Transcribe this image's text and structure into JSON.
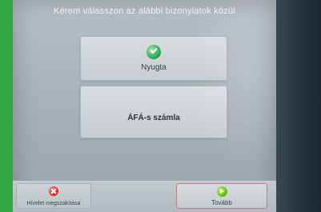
{
  "header": {
    "instruction": "Kérem válasszon az alábbi bizonylatok közül"
  },
  "choices": [
    {
      "label": "Nyugta",
      "icon": "check-icon"
    },
    {
      "label": "ÁFÁ-s számla"
    }
  ],
  "footer": {
    "cancel_label": "Hívelet megszakítása",
    "cancel_icon": "x-icon",
    "next_label": "Tovább",
    "next_icon": "next-arrow-icon"
  },
  "colors": {
    "frame": "#34a845",
    "accent_next": "#62c11b",
    "cancel": "#d82323"
  }
}
